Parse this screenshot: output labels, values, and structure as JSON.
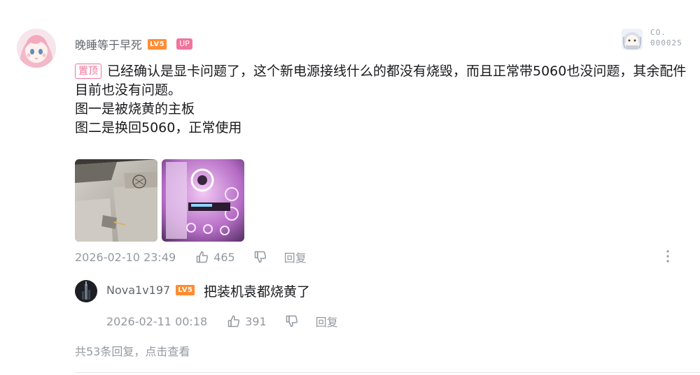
{
  "comment": {
    "username": "晚睡等于早死",
    "level": "LV5",
    "up_badge": "UP",
    "fan_badge": {
      "line1": "CO.",
      "line2": "000025"
    },
    "pin_tag": "置顶",
    "lines": [
      "已经确认是显卡问题了，这个新电源接线什么的都没有烧毁，而且正常带5060也没问题，其余配件目前也没有问题。",
      "图一是被烧黄的主板",
      "图二是换回5060，正常使用"
    ],
    "images": [
      "burned-motherboard-photo",
      "pc-case-pink-lighting-photo"
    ],
    "time": "2026-02-10 23:49",
    "likes": "465",
    "reply_label": "回复"
  },
  "reply": {
    "username": "Nova1v197",
    "level": "LV5",
    "text": "把装机袁都烧黄了",
    "time": "2026-02-11 00:18",
    "likes": "391",
    "reply_label": "回复"
  },
  "view_all": "共53条回复，点击查看",
  "colors": {
    "pink": "#f0749c",
    "level_orange": "#ff8c33",
    "meta_gray": "#9499a0",
    "name_gray": "#61666d"
  }
}
